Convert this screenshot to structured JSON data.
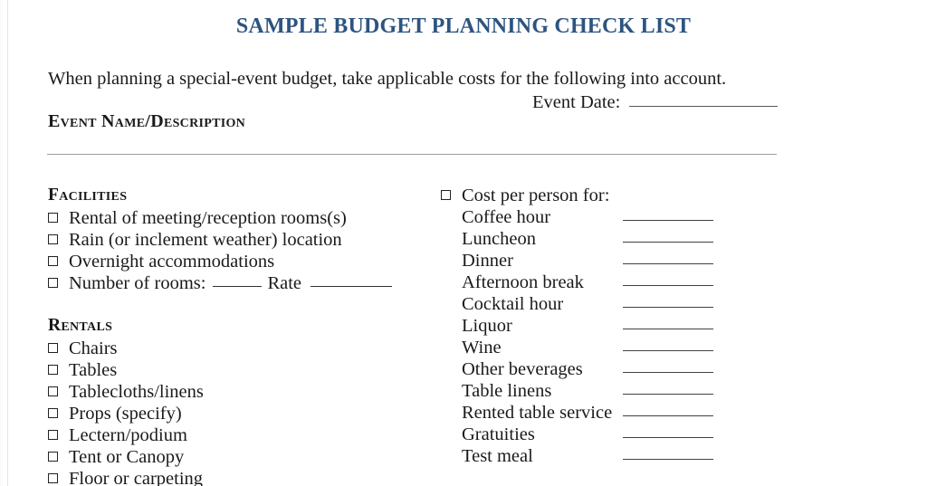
{
  "document": {
    "title": "SAMPLE BUDGET PLANNING CHECK LIST",
    "title_color": "#2d5480",
    "intro": "When planning a special-event budget, take applicable costs for the following into account.",
    "event_date_label": "Event Date:",
    "event_name_heading": "Event Name/Description"
  },
  "left_column": {
    "facilities": {
      "heading": "Facilities",
      "items": [
        {
          "label": "Rental of meeting/reception rooms(s)",
          "checkbox": true
        },
        {
          "label": "Rain (or inclement weather) location",
          "checkbox": true
        },
        {
          "label": "Overnight accommodations",
          "checkbox": true
        }
      ],
      "rooms_row": {
        "checkbox": true,
        "label_prefix": "Number of rooms:",
        "label_middle": "Rate"
      }
    },
    "rentals": {
      "heading": "Rentals",
      "items": [
        {
          "label": "Chairs",
          "checkbox": true
        },
        {
          "label": "Tables",
          "checkbox": true
        },
        {
          "label": "Tablecloths/linens",
          "checkbox": true
        },
        {
          "label": "Props (specify)",
          "checkbox": true
        },
        {
          "label": "Lectern/podium",
          "checkbox": true
        },
        {
          "label": "Tent or Canopy",
          "checkbox": true
        },
        {
          "label": "Floor or carpeting",
          "checkbox": true
        }
      ]
    }
  },
  "right_column": {
    "cost_per_person": {
      "header_label": "Cost per person for:",
      "header_checkbox": true,
      "items": [
        {
          "label": "Coffee hour",
          "rule": true
        },
        {
          "label": "Luncheon",
          "rule": true
        },
        {
          "label": "Dinner",
          "rule": true
        },
        {
          "label": "Afternoon break",
          "rule": true
        },
        {
          "label": "Cocktail hour",
          "rule": true
        },
        {
          "label": "Liquor",
          "rule": true
        },
        {
          "label": "Wine",
          "rule": true
        },
        {
          "label": "Other beverages",
          "rule": true
        },
        {
          "label": "Table linens",
          "rule": true
        },
        {
          "label": "Rented table service",
          "rule": true
        },
        {
          "label": "Gratuities",
          "rule": true
        },
        {
          "label": "Test meal",
          "rule": true
        }
      ]
    }
  }
}
